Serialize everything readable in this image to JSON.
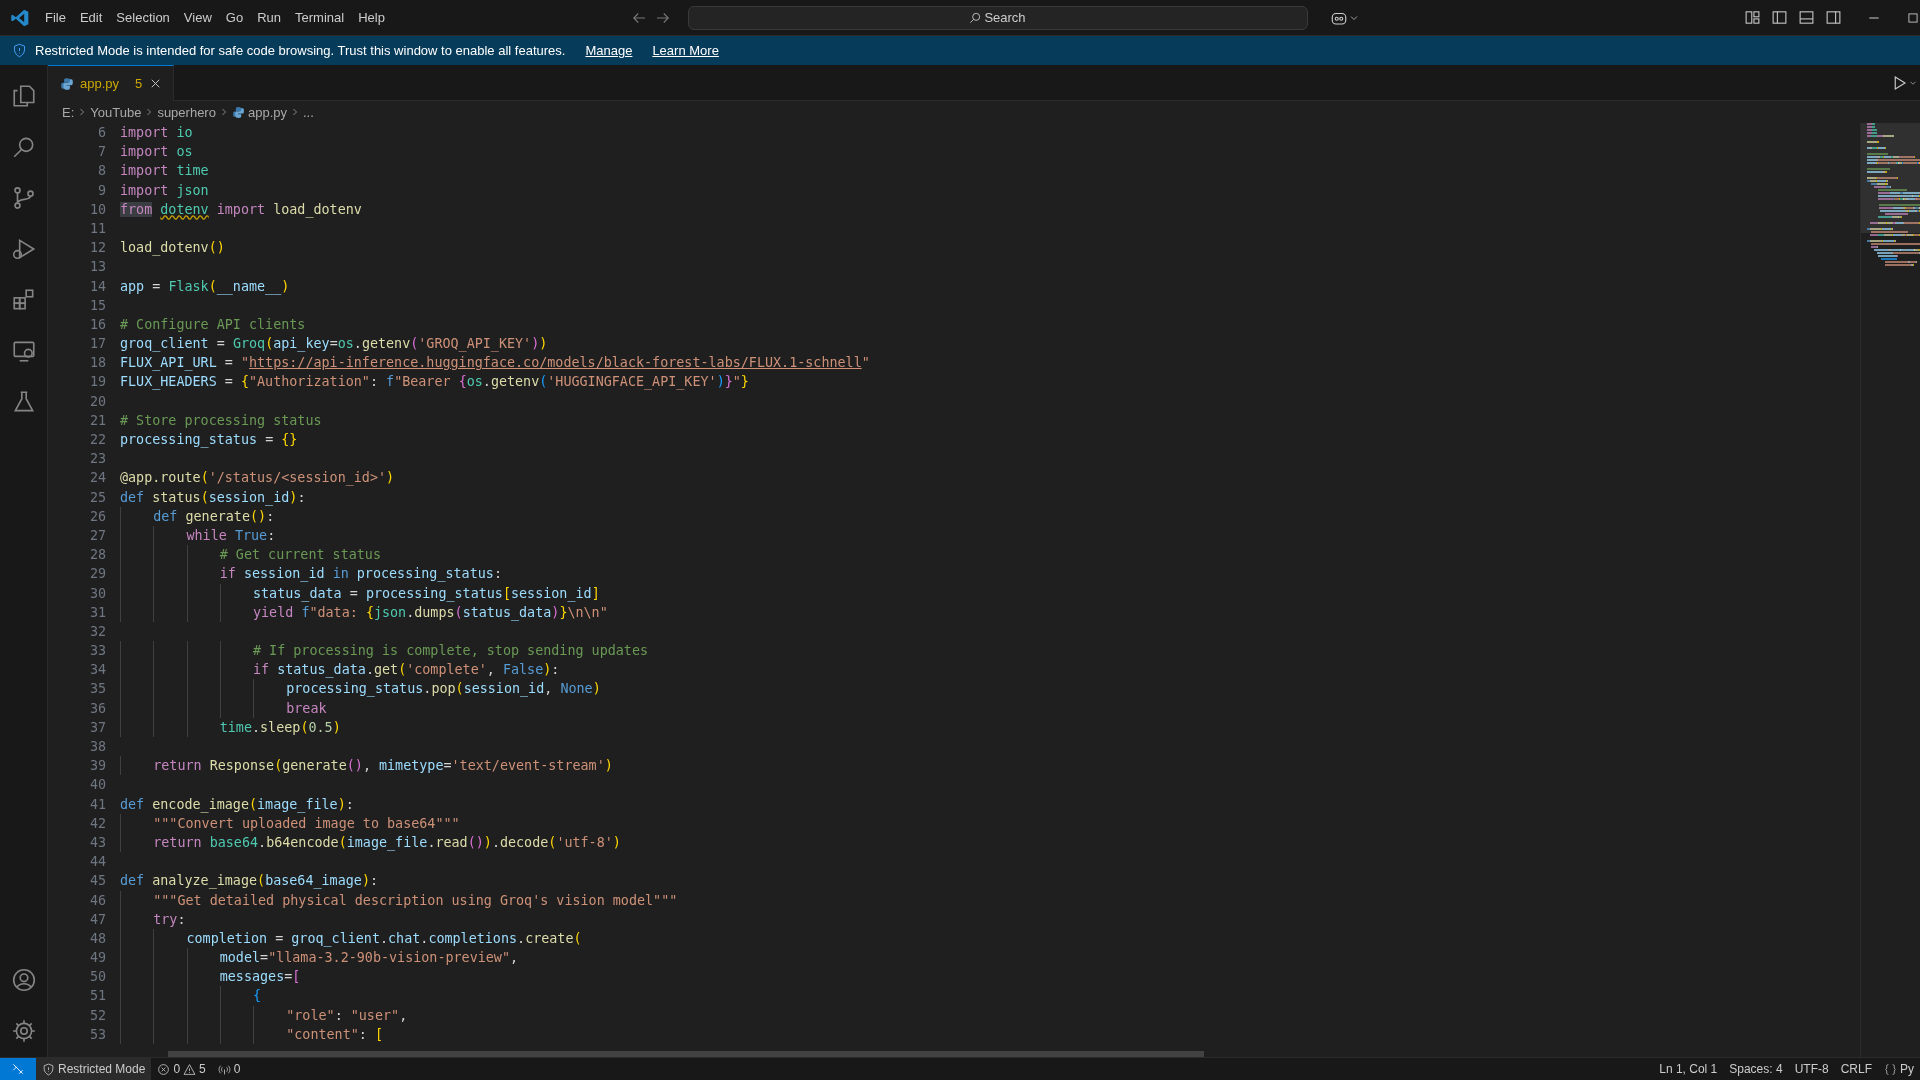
{
  "title_bar": {
    "menu": [
      "File",
      "Edit",
      "Selection",
      "View",
      "Go",
      "Run",
      "Terminal",
      "Help"
    ],
    "search": {
      "placeholder": "Search"
    }
  },
  "banner": {
    "message": "Restricted Mode is intended for safe code browsing. Trust this window to enable all features.",
    "links": [
      "Manage",
      "Learn More"
    ]
  },
  "editor": {
    "tabs": [
      {
        "label": "app.py",
        "problems": "5",
        "selected": true
      }
    ],
    "breadcrumb": [
      "E:",
      "YouTube",
      "superhero",
      "app.py",
      "..."
    ],
    "lines": [
      {
        "number": "6",
        "tokens": [
          {
            "kind": "kw",
            "text": "import"
          },
          {
            "kind": "mod",
            "text": " io"
          }
        ]
      },
      {
        "number": "7",
        "tokens": [
          {
            "kind": "kw",
            "text": "import"
          },
          {
            "kind": "mod",
            "text": " os"
          }
        ]
      },
      {
        "number": "8",
        "tokens": [
          {
            "kind": "kw",
            "text": "import"
          },
          {
            "kind": "mod",
            "text": " time"
          }
        ]
      },
      {
        "number": "9",
        "tokens": [
          {
            "kind": "kw",
            "text": "import"
          },
          {
            "kind": "mod",
            "text": " json"
          }
        ]
      },
      {
        "number": "10",
        "tokens": [
          {
            "kind": "hl",
            "text": "from"
          },
          {
            "kind": "warn",
            "text": " dotenv"
          },
          {
            "kind": "kw",
            "text": " import"
          },
          {
            "kind": "fn",
            "text": " load_dotenv"
          }
        ]
      },
      {
        "number": "11"
      },
      {
        "number": "12",
        "tokens": [
          {
            "kind": "fn",
            "text": "load_dotenv"
          },
          {
            "kind": "b1",
            "text": "()"
          }
        ]
      },
      {
        "number": "13"
      },
      {
        "number": "14",
        "tokens": [
          {
            "kind": "var",
            "text": "app"
          },
          {
            "kind": "p",
            "text": " = "
          },
          {
            "kind": "mod",
            "text": "Flask"
          },
          {
            "kind": "b1",
            "text": "("
          },
          {
            "kind": "var",
            "text": "__name__"
          },
          {
            "kind": "b1",
            "text": ")"
          }
        ]
      },
      {
        "number": "15"
      },
      {
        "number": "16",
        "tokens": [
          {
            "kind": "com",
            "text": "# Configure API clients"
          }
        ]
      },
      {
        "number": "17",
        "tokens": [
          {
            "kind": "var",
            "text": "groq_client"
          },
          {
            "kind": "p",
            "text": " = "
          },
          {
            "kind": "mod",
            "text": "Groq"
          },
          {
            "kind": "b1",
            "text": "("
          },
          {
            "kind": "var",
            "text": "api_key"
          },
          {
            "kind": "p",
            "text": "="
          },
          {
            "kind": "mod",
            "text": "os"
          },
          {
            "kind": "p",
            "text": "."
          },
          {
            "kind": "fn",
            "text": "getenv"
          },
          {
            "kind": "b2",
            "text": "("
          },
          {
            "kind": "str",
            "text": "'GROQ_API_KEY'"
          },
          {
            "kind": "b2",
            "text": ")"
          },
          {
            "kind": "b1",
            "text": ")"
          }
        ]
      },
      {
        "number": "18",
        "tokens": [
          {
            "kind": "var",
            "text": "FLUX_API_URL"
          },
          {
            "kind": "p",
            "text": " = "
          },
          {
            "kind": "str",
            "text": "\""
          },
          {
            "kind": "url",
            "text": "https://api-inference.huggingface.co/models/black-forest-labs/FLUX.1-schnell"
          },
          {
            "kind": "str",
            "text": "\""
          }
        ]
      },
      {
        "number": "19",
        "tokens": [
          {
            "kind": "var",
            "text": "FLUX_HEADERS"
          },
          {
            "kind": "p",
            "text": " = "
          },
          {
            "kind": "b1",
            "text": "{"
          },
          {
            "kind": "str",
            "text": "\"Authorization\""
          },
          {
            "kind": "p",
            "text": ": "
          },
          {
            "kind": "st",
            "text": "f"
          },
          {
            "kind": "str",
            "text": "\"Bearer "
          },
          {
            "kind": "b2",
            "text": "{"
          },
          {
            "kind": "mod",
            "text": "os"
          },
          {
            "kind": "p",
            "text": "."
          },
          {
            "kind": "fn",
            "text": "getenv"
          },
          {
            "kind": "b3",
            "text": "("
          },
          {
            "kind": "str",
            "text": "'HUGGINGFACE_API_KEY'"
          },
          {
            "kind": "b3",
            "text": ")"
          },
          {
            "kind": "b2",
            "text": "}"
          },
          {
            "kind": "str",
            "text": "\""
          },
          {
            "kind": "b1",
            "text": "}"
          }
        ]
      },
      {
        "number": "20"
      },
      {
        "number": "21",
        "tokens": [
          {
            "kind": "com",
            "text": "# Store processing status"
          }
        ]
      },
      {
        "number": "22",
        "tokens": [
          {
            "kind": "var",
            "text": "processing_status"
          },
          {
            "kind": "p",
            "text": " = "
          },
          {
            "kind": "b1",
            "text": "{}"
          }
        ]
      },
      {
        "number": "23"
      },
      {
        "number": "24",
        "tokens": [
          {
            "kind": "fn",
            "text": "@app.route"
          },
          {
            "kind": "b1",
            "text": "("
          },
          {
            "kind": "str",
            "text": "'/status/<session_id>'"
          },
          {
            "kind": "b1",
            "text": ")"
          }
        ]
      },
      {
        "number": "25",
        "tokens": [
          {
            "kind": "st",
            "text": "def"
          },
          {
            "kind": "fn",
            "text": " status"
          },
          {
            "kind": "b1",
            "text": "("
          },
          {
            "kind": "var",
            "text": "session_id"
          },
          {
            "kind": "b1",
            "text": ")"
          },
          {
            "kind": "p",
            "text": ":"
          }
        ]
      },
      {
        "number": "26",
        "tokens": [
          {
            "kind": "st",
            "text": "    def"
          },
          {
            "kind": "fn",
            "text": " generate"
          },
          {
            "kind": "b1",
            "text": "()"
          },
          {
            "kind": "p",
            "text": ":"
          }
        ]
      },
      {
        "number": "27",
        "tokens": [
          {
            "kind": "kw",
            "text": "        while"
          },
          {
            "kind": "st",
            "text": " True"
          },
          {
            "kind": "p",
            "text": ":"
          }
        ]
      },
      {
        "number": "28",
        "tokens": [
          {
            "kind": "com",
            "text": "            # Get current status"
          }
        ]
      },
      {
        "number": "29",
        "tokens": [
          {
            "kind": "kw",
            "text": "            if"
          },
          {
            "kind": "var",
            "text": " session_id"
          },
          {
            "kind": "st",
            "text": " in"
          },
          {
            "kind": "var",
            "text": " processing_status"
          },
          {
            "kind": "p",
            "text": ":"
          }
        ]
      },
      {
        "number": "30",
        "tokens": [
          {
            "kind": "var",
            "text": "                status_data"
          },
          {
            "kind": "p",
            "text": " = "
          },
          {
            "kind": "var",
            "text": "processing_status"
          },
          {
            "kind": "b1",
            "text": "["
          },
          {
            "kind": "var",
            "text": "session_id"
          },
          {
            "kind": "b1",
            "text": "]"
          }
        ]
      },
      {
        "number": "31",
        "tokens": [
          {
            "kind": "kw",
            "text": "                yield"
          },
          {
            "kind": "st",
            "text": " f"
          },
          {
            "kind": "str",
            "text": "\"data: "
          },
          {
            "kind": "b1",
            "text": "{"
          },
          {
            "kind": "mod",
            "text": "json"
          },
          {
            "kind": "p",
            "text": "."
          },
          {
            "kind": "fn",
            "text": "dumps"
          },
          {
            "kind": "b2",
            "text": "("
          },
          {
            "kind": "var",
            "text": "status_data"
          },
          {
            "kind": "b2",
            "text": ")"
          },
          {
            "kind": "b1",
            "text": "}"
          },
          {
            "kind": "str",
            "text": "\\n\\n\""
          }
        ]
      },
      {
        "number": "32"
      },
      {
        "number": "33",
        "tokens": [
          {
            "kind": "com",
            "text": "                # If processing is complete, stop sending updates"
          }
        ]
      },
      {
        "number": "34",
        "tokens": [
          {
            "kind": "kw",
            "text": "                if"
          },
          {
            "kind": "var",
            "text": " status_data"
          },
          {
            "kind": "p",
            "text": "."
          },
          {
            "kind": "fn",
            "text": "get"
          },
          {
            "kind": "b1",
            "text": "("
          },
          {
            "kind": "str",
            "text": "'complete'"
          },
          {
            "kind": "p",
            "text": ", "
          },
          {
            "kind": "st",
            "text": "False"
          },
          {
            "kind": "b1",
            "text": ")"
          },
          {
            "kind": "p",
            "text": ":"
          }
        ]
      },
      {
        "number": "35",
        "tokens": [
          {
            "kind": "var",
            "text": "                    processing_status"
          },
          {
            "kind": "p",
            "text": "."
          },
          {
            "kind": "fn",
            "text": "pop"
          },
          {
            "kind": "b1",
            "text": "("
          },
          {
            "kind": "var",
            "text": "session_id"
          },
          {
            "kind": "p",
            "text": ", "
          },
          {
            "kind": "st",
            "text": "None"
          },
          {
            "kind": "b1",
            "text": ")"
          }
        ]
      },
      {
        "number": "36",
        "tokens": [
          {
            "kind": "kw",
            "text": "                    break"
          }
        ]
      },
      {
        "number": "37",
        "tokens": [
          {
            "kind": "mod",
            "text": "            time"
          },
          {
            "kind": "p",
            "text": "."
          },
          {
            "kind": "fn",
            "text": "sleep"
          },
          {
            "kind": "b1",
            "text": "("
          },
          {
            "kind": "num",
            "text": "0.5"
          },
          {
            "kind": "b1",
            "text": ")"
          }
        ]
      },
      {
        "number": "38"
      },
      {
        "number": "39",
        "tokens": [
          {
            "kind": "kw",
            "text": "    return"
          },
          {
            "kind": "fn",
            "text": " Response"
          },
          {
            "kind": "b1",
            "text": "("
          },
          {
            "kind": "fn",
            "text": "generate"
          },
          {
            "kind": "b2",
            "text": "()"
          },
          {
            "kind": "p",
            "text": ", "
          },
          {
            "kind": "var",
            "text": "mimetype"
          },
          {
            "kind": "p",
            "text": "="
          },
          {
            "kind": "str",
            "text": "'text/event-stream'"
          },
          {
            "kind": "b1",
            "text": ")"
          }
        ]
      },
      {
        "number": "40"
      },
      {
        "number": "41",
        "tokens": [
          {
            "kind": "st",
            "text": "def"
          },
          {
            "kind": "fn",
            "text": " encode_image"
          },
          {
            "kind": "b1",
            "text": "("
          },
          {
            "kind": "var",
            "text": "image_file"
          },
          {
            "kind": "b1",
            "text": ")"
          },
          {
            "kind": "p",
            "text": ":"
          }
        ]
      },
      {
        "number": "42",
        "tokens": [
          {
            "kind": "str",
            "text": "    \"\"\"Convert uploaded image to base64\"\"\""
          }
        ]
      },
      {
        "number": "43",
        "tokens": [
          {
            "kind": "kw",
            "text": "    return"
          },
          {
            "kind": "mod",
            "text": " base64"
          },
          {
            "kind": "p",
            "text": "."
          },
          {
            "kind": "fn",
            "text": "b64encode"
          },
          {
            "kind": "b1",
            "text": "("
          },
          {
            "kind": "var",
            "text": "image_file"
          },
          {
            "kind": "p",
            "text": "."
          },
          {
            "kind": "fn",
            "text": "read"
          },
          {
            "kind": "b2",
            "text": "()"
          },
          {
            "kind": "b1",
            "text": ")"
          },
          {
            "kind": "p",
            "text": "."
          },
          {
            "kind": "fn",
            "text": "decode"
          },
          {
            "kind": "b1",
            "text": "("
          },
          {
            "kind": "str",
            "text": "'utf-8'"
          },
          {
            "kind": "b1",
            "text": ")"
          }
        ]
      },
      {
        "number": "44"
      },
      {
        "number": "45",
        "tokens": [
          {
            "kind": "st",
            "text": "def"
          },
          {
            "kind": "fn",
            "text": " analyze_image"
          },
          {
            "kind": "b1",
            "text": "("
          },
          {
            "kind": "var",
            "text": "base64_image"
          },
          {
            "kind": "b1",
            "text": ")"
          },
          {
            "kind": "p",
            "text": ":"
          }
        ]
      },
      {
        "number": "46",
        "tokens": [
          {
            "kind": "str",
            "text": "    \"\"\"Get detailed physical description using Groq's vision model\"\"\""
          }
        ]
      },
      {
        "number": "47",
        "tokens": [
          {
            "kind": "kw",
            "text": "    try"
          },
          {
            "kind": "p",
            "text": ":"
          }
        ]
      },
      {
        "number": "48",
        "tokens": [
          {
            "kind": "var",
            "text": "        completion"
          },
          {
            "kind": "p",
            "text": " = "
          },
          {
            "kind": "var",
            "text": "groq_client"
          },
          {
            "kind": "p",
            "text": "."
          },
          {
            "kind": "var",
            "text": "chat"
          },
          {
            "kind": "p",
            "text": "."
          },
          {
            "kind": "var",
            "text": "completions"
          },
          {
            "kind": "p",
            "text": "."
          },
          {
            "kind": "fn",
            "text": "create"
          },
          {
            "kind": "b1",
            "text": "("
          }
        ]
      },
      {
        "number": "49",
        "tokens": [
          {
            "kind": "var",
            "text": "            model"
          },
          {
            "kind": "p",
            "text": "="
          },
          {
            "kind": "str",
            "text": "\"llama-3.2-90b-vision-preview\""
          },
          {
            "kind": "p",
            "text": ","
          }
        ]
      },
      {
        "number": "50",
        "tokens": [
          {
            "kind": "var",
            "text": "            messages"
          },
          {
            "kind": "p",
            "text": "="
          },
          {
            "kind": "b2",
            "text": "["
          }
        ]
      },
      {
        "number": "51",
        "tokens": [
          {
            "kind": "b3",
            "text": "                {"
          }
        ]
      },
      {
        "number": "52",
        "tokens": [
          {
            "kind": "str",
            "text": "                    \"role\""
          },
          {
            "kind": "p",
            "text": ": "
          },
          {
            "kind": "str",
            "text": "\"user\""
          },
          {
            "kind": "p",
            "text": ","
          }
        ]
      },
      {
        "number": "53",
        "tokens": [
          {
            "kind": "str",
            "text": "                    \"content\""
          },
          {
            "kind": "p",
            "text": ": "
          },
          {
            "kind": "b1",
            "text": "["
          }
        ]
      }
    ]
  },
  "status_bar": {
    "mode": "Restricted Mode",
    "errors": "0",
    "warnings": "5",
    "ports": "0",
    "position": "Ln 1, Col 1",
    "spaces": "Spaces: 4",
    "encoding": "UTF-8",
    "eol": "CRLF",
    "language": "Py"
  }
}
